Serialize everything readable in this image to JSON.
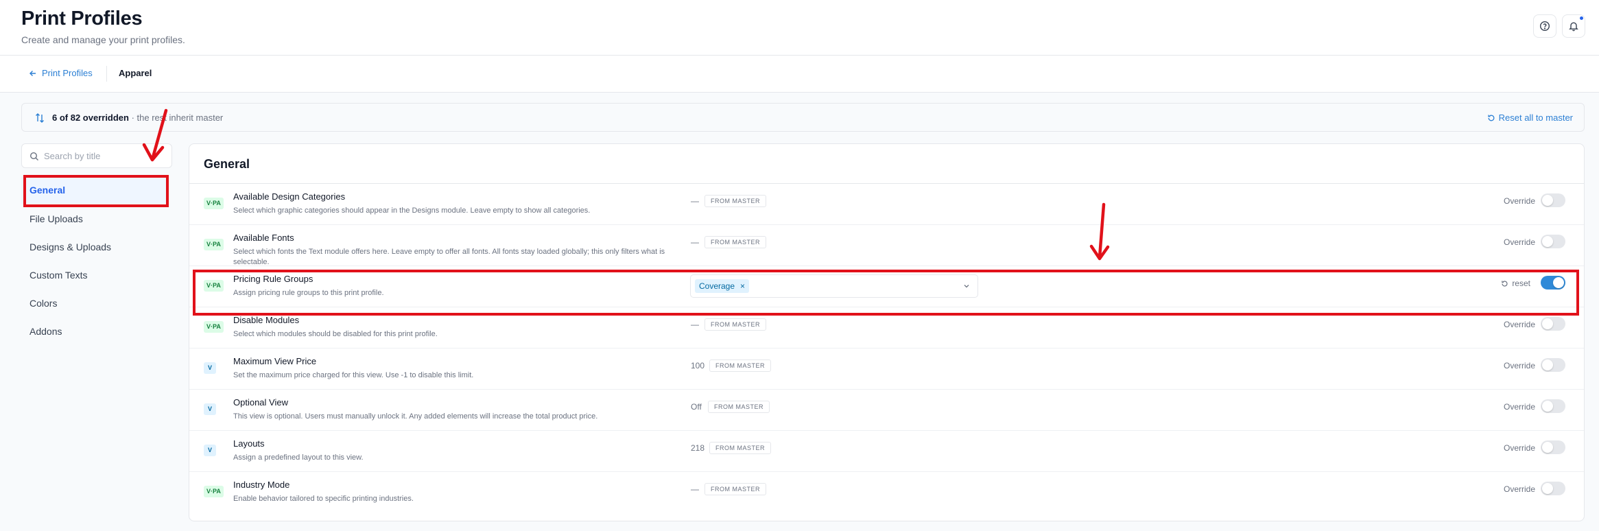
{
  "header": {
    "title": "Print Profiles",
    "subtitle": "Create and manage your print profiles.",
    "help_icon": "help-circle-icon",
    "bell_icon": "bell-icon"
  },
  "breadcrumb": {
    "back_label": "Print Profiles",
    "current": "Apparel"
  },
  "summary": {
    "count": "6 of 82 overridden",
    "rest": " · the rest inherit master",
    "reset_all": "Reset all to master"
  },
  "search": {
    "placeholder": "Search by title"
  },
  "nav": {
    "items": [
      {
        "label": "General",
        "active": true
      },
      {
        "label": "File Uploads",
        "active": false
      },
      {
        "label": "Designs & Uploads",
        "active": false
      },
      {
        "label": "Custom Texts",
        "active": false
      },
      {
        "label": "Colors",
        "active": false
      },
      {
        "label": "Addons",
        "active": false
      }
    ]
  },
  "section": {
    "title": "General",
    "from_master": "FROM MASTER",
    "override_label": "Override",
    "reset_label": "reset",
    "rows": [
      {
        "badge": "V·PA",
        "title": "Available Design Categories",
        "desc": "Select which graphic categories should appear in the Designs module. Leave empty to show all categories.",
        "value": "—",
        "override": false
      },
      {
        "badge": "V·PA",
        "title": "Available Fonts",
        "desc": "Select which fonts the Text module offers here. Leave empty to offer all fonts. All fonts stay loaded globally; this only filters what is selectable.",
        "value": "—",
        "override": false
      },
      {
        "badge": "V·PA",
        "title": "Pricing Rule Groups",
        "desc": "Assign pricing rule groups to this print profile.",
        "selected_tag": "Coverage",
        "override": true
      },
      {
        "badge": "V·PA",
        "title": "Disable Modules",
        "desc": "Select which modules should be disabled for this print profile.",
        "value": "—",
        "override": false
      },
      {
        "badge": "V",
        "title": "Maximum View Price",
        "desc": "Set the maximum price charged for this view. Use -1 to disable this limit.",
        "value": "100",
        "override": false
      },
      {
        "badge": "V",
        "title": "Optional View",
        "desc": "This view is optional. Users must manually unlock it. Any added elements will increase the total product price.",
        "value": "Off",
        "override": false
      },
      {
        "badge": "V",
        "title": "Layouts",
        "desc": "Assign a predefined layout to this view.",
        "value": "218",
        "override": false
      },
      {
        "badge": "V·PA",
        "title": "Industry Mode",
        "desc": "Enable behavior tailored to specific printing industries.",
        "value": "—",
        "override": false
      }
    ]
  },
  "colors": {
    "accent": "#2b7fd4",
    "toggle_on": "#2f8ad8",
    "annotation": "#e1111a"
  }
}
